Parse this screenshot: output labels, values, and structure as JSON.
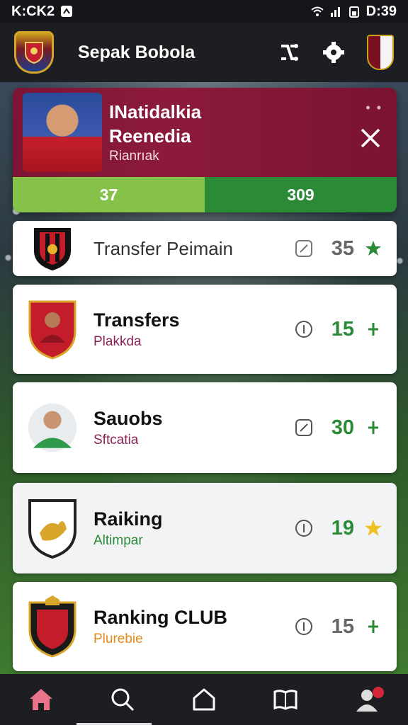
{
  "status_bar": {
    "left_text": "K:CK2",
    "right_text": "D:39"
  },
  "app_bar": {
    "title": "Sepak Bobola",
    "icons": [
      "shuffle-icon",
      "settings-icon",
      "club-badge-icon"
    ]
  },
  "hero": {
    "name_line1": "INatidalkia",
    "name_line2": "Reenedia",
    "subtitle": "Rianrıak",
    "dots": "• •",
    "stats": {
      "left": "37",
      "right": "309"
    },
    "colors": {
      "banner": "#86183a",
      "stat_left": "#86c24a",
      "stat_right": "#2a8a36"
    }
  },
  "items": [
    {
      "title": "Transfer Peimain",
      "subtitle": "",
      "count": "35",
      "end_icon": "star-icon",
      "count_color": "#555555",
      "end_color": "#2a8a36"
    },
    {
      "title": "Transfers",
      "subtitle": "Plakkda",
      "subtitle_color": "#8a2457",
      "count": "15",
      "end_icon": "plus-icon",
      "count_color": "#2a8a36",
      "end_color": "#2a8a36"
    },
    {
      "title": "Sauobs",
      "subtitle": "Sftcatia",
      "subtitle_color": "#8a2457",
      "count": "30",
      "end_icon": "plus-icon",
      "count_color": "#2a8a36",
      "end_color": "#2a8a36"
    },
    {
      "title": "Raiking",
      "subtitle": "Altimpar",
      "subtitle_color": "#2a8a36",
      "count": "19",
      "end_icon": "star-icon",
      "count_color": "#2a8a36",
      "end_color": "#f0c020"
    },
    {
      "title": "Ranking CLUB",
      "subtitle": "Plurebie",
      "subtitle_color": "#e08a1a",
      "count": "15",
      "end_icon": "plus-icon",
      "count_color": "#555555",
      "end_color": "#2a8a36"
    }
  ],
  "bottom_nav": [
    "home-icon",
    "search-icon",
    "house-outline-icon",
    "book-icon",
    "profile-icon"
  ]
}
